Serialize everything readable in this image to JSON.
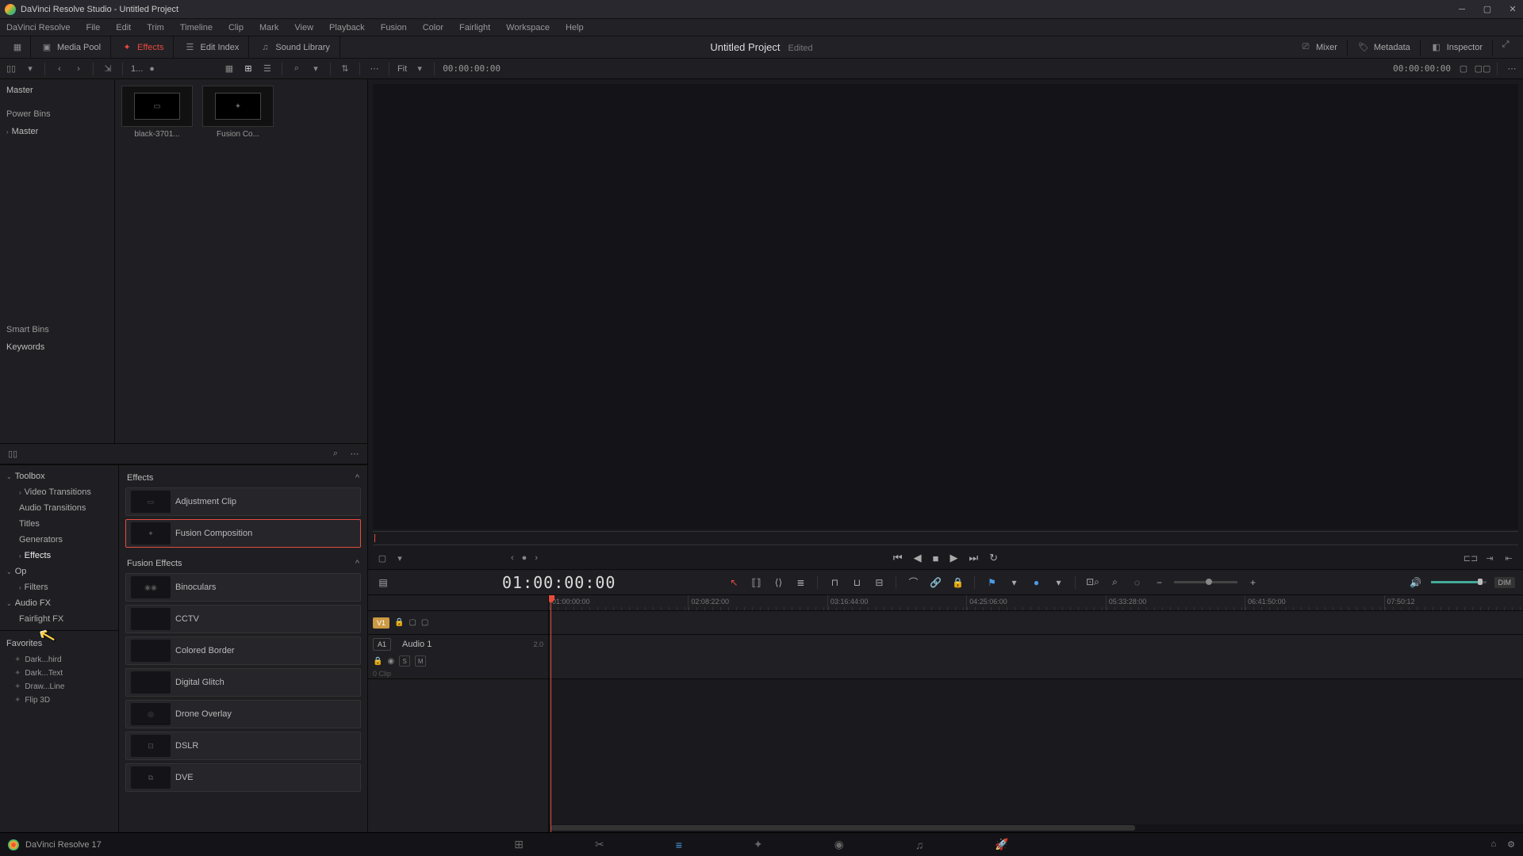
{
  "titlebar": {
    "text": "DaVinci Resolve Studio - Untitled Project"
  },
  "menu": [
    "DaVinci Resolve",
    "File",
    "Edit",
    "Trim",
    "Timeline",
    "Clip",
    "Mark",
    "View",
    "Playback",
    "Fusion",
    "Color",
    "Fairlight",
    "Workspace",
    "Help"
  ],
  "toolbar": {
    "media_pool": "Media Pool",
    "effects": "Effects",
    "edit_index": "Edit Index",
    "sound_library": "Sound Library",
    "mixer": "Mixer",
    "metadata": "Metadata",
    "inspector": "Inspector"
  },
  "project": {
    "name": "Untitled Project",
    "status": "Edited"
  },
  "subtoolbar": {
    "zoom_label": "1...",
    "fit": "Fit",
    "tc": "00:00:00:00",
    "tc_right": "00:00:00:00"
  },
  "media_tree": {
    "master": "Master",
    "power_bins": "Power Bins",
    "pb_master": "Master",
    "smart_bins": "Smart Bins",
    "keywords": "Keywords"
  },
  "clips": [
    {
      "label": "black-3701..."
    },
    {
      "label": "Fusion Co..."
    }
  ],
  "fx_tree": {
    "toolbox": "Toolbox",
    "video_transitions": "Video Transitions",
    "audio_transitions": "Audio Transitions",
    "titles": "Titles",
    "generators": "Generators",
    "effects": "Effects",
    "openfx": "Op",
    "filters": "Filters",
    "audiofx": "Audio FX",
    "fairlightfx": "Fairlight FX"
  },
  "fx_sections": {
    "effects": "Effects",
    "fusion_effects": "Fusion Effects"
  },
  "fx_items_top": [
    {
      "name": "Adjustment Clip"
    },
    {
      "name": "Fusion Composition"
    }
  ],
  "fx_items_fusion": [
    {
      "name": "Binoculars"
    },
    {
      "name": "CCTV"
    },
    {
      "name": "Colored Border"
    },
    {
      "name": "Digital Glitch"
    },
    {
      "name": "Drone Overlay"
    },
    {
      "name": "DSLR"
    },
    {
      "name": "DVE"
    }
  ],
  "favorites": {
    "header": "Favorites",
    "items": [
      "Dark...hird",
      "Dark...Text",
      "Draw...Line",
      "Flip 3D"
    ]
  },
  "timeline": {
    "tc": "01:00:00:00",
    "ruler": [
      "01:00:00:00",
      "02:08:22:00",
      "03:16:44:00",
      "04:25:06:00",
      "05:33:28:00",
      "06:41:50:00",
      "07:50:12"
    ],
    "v1": "V1",
    "a1": "A1",
    "a1_name": "Audio 1",
    "a1_ch": "2.0",
    "a1_clip": "0 Clip",
    "s": "S",
    "m": "M"
  },
  "dim": "DIM",
  "pagebar": {
    "version": "DaVinci Resolve 17"
  }
}
